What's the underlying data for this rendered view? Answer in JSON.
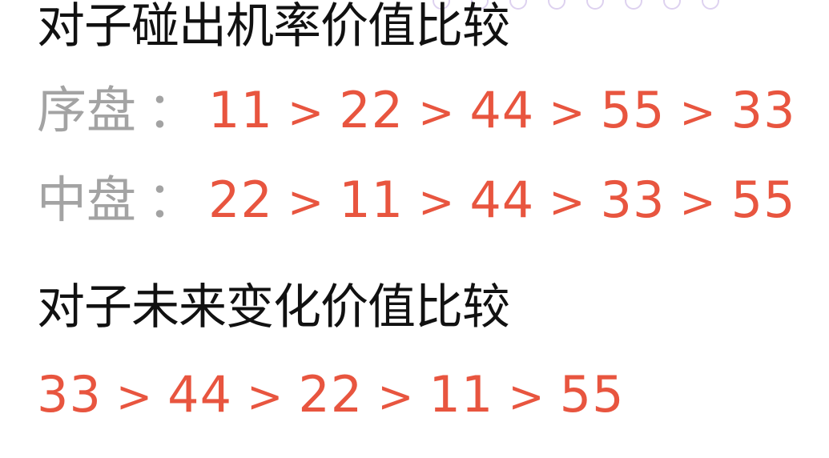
{
  "title_collision": "对子碰出机率价值比较",
  "row_early": {
    "label": "序盘",
    "colon": "：",
    "values": [
      "11",
      "22",
      "44",
      "55",
      "33"
    ]
  },
  "row_mid": {
    "label": "中盘",
    "colon": "：",
    "values": [
      "22",
      "11",
      "44",
      "33",
      "55"
    ]
  },
  "title_future": "对子未来变化价值比较",
  "row_future": {
    "values": [
      "33",
      "44",
      "22",
      "11",
      "55"
    ]
  },
  "separator": ">",
  "colors": {
    "heading": "#111111",
    "label": "#a3a3a3",
    "accent": "#e8553f"
  }
}
